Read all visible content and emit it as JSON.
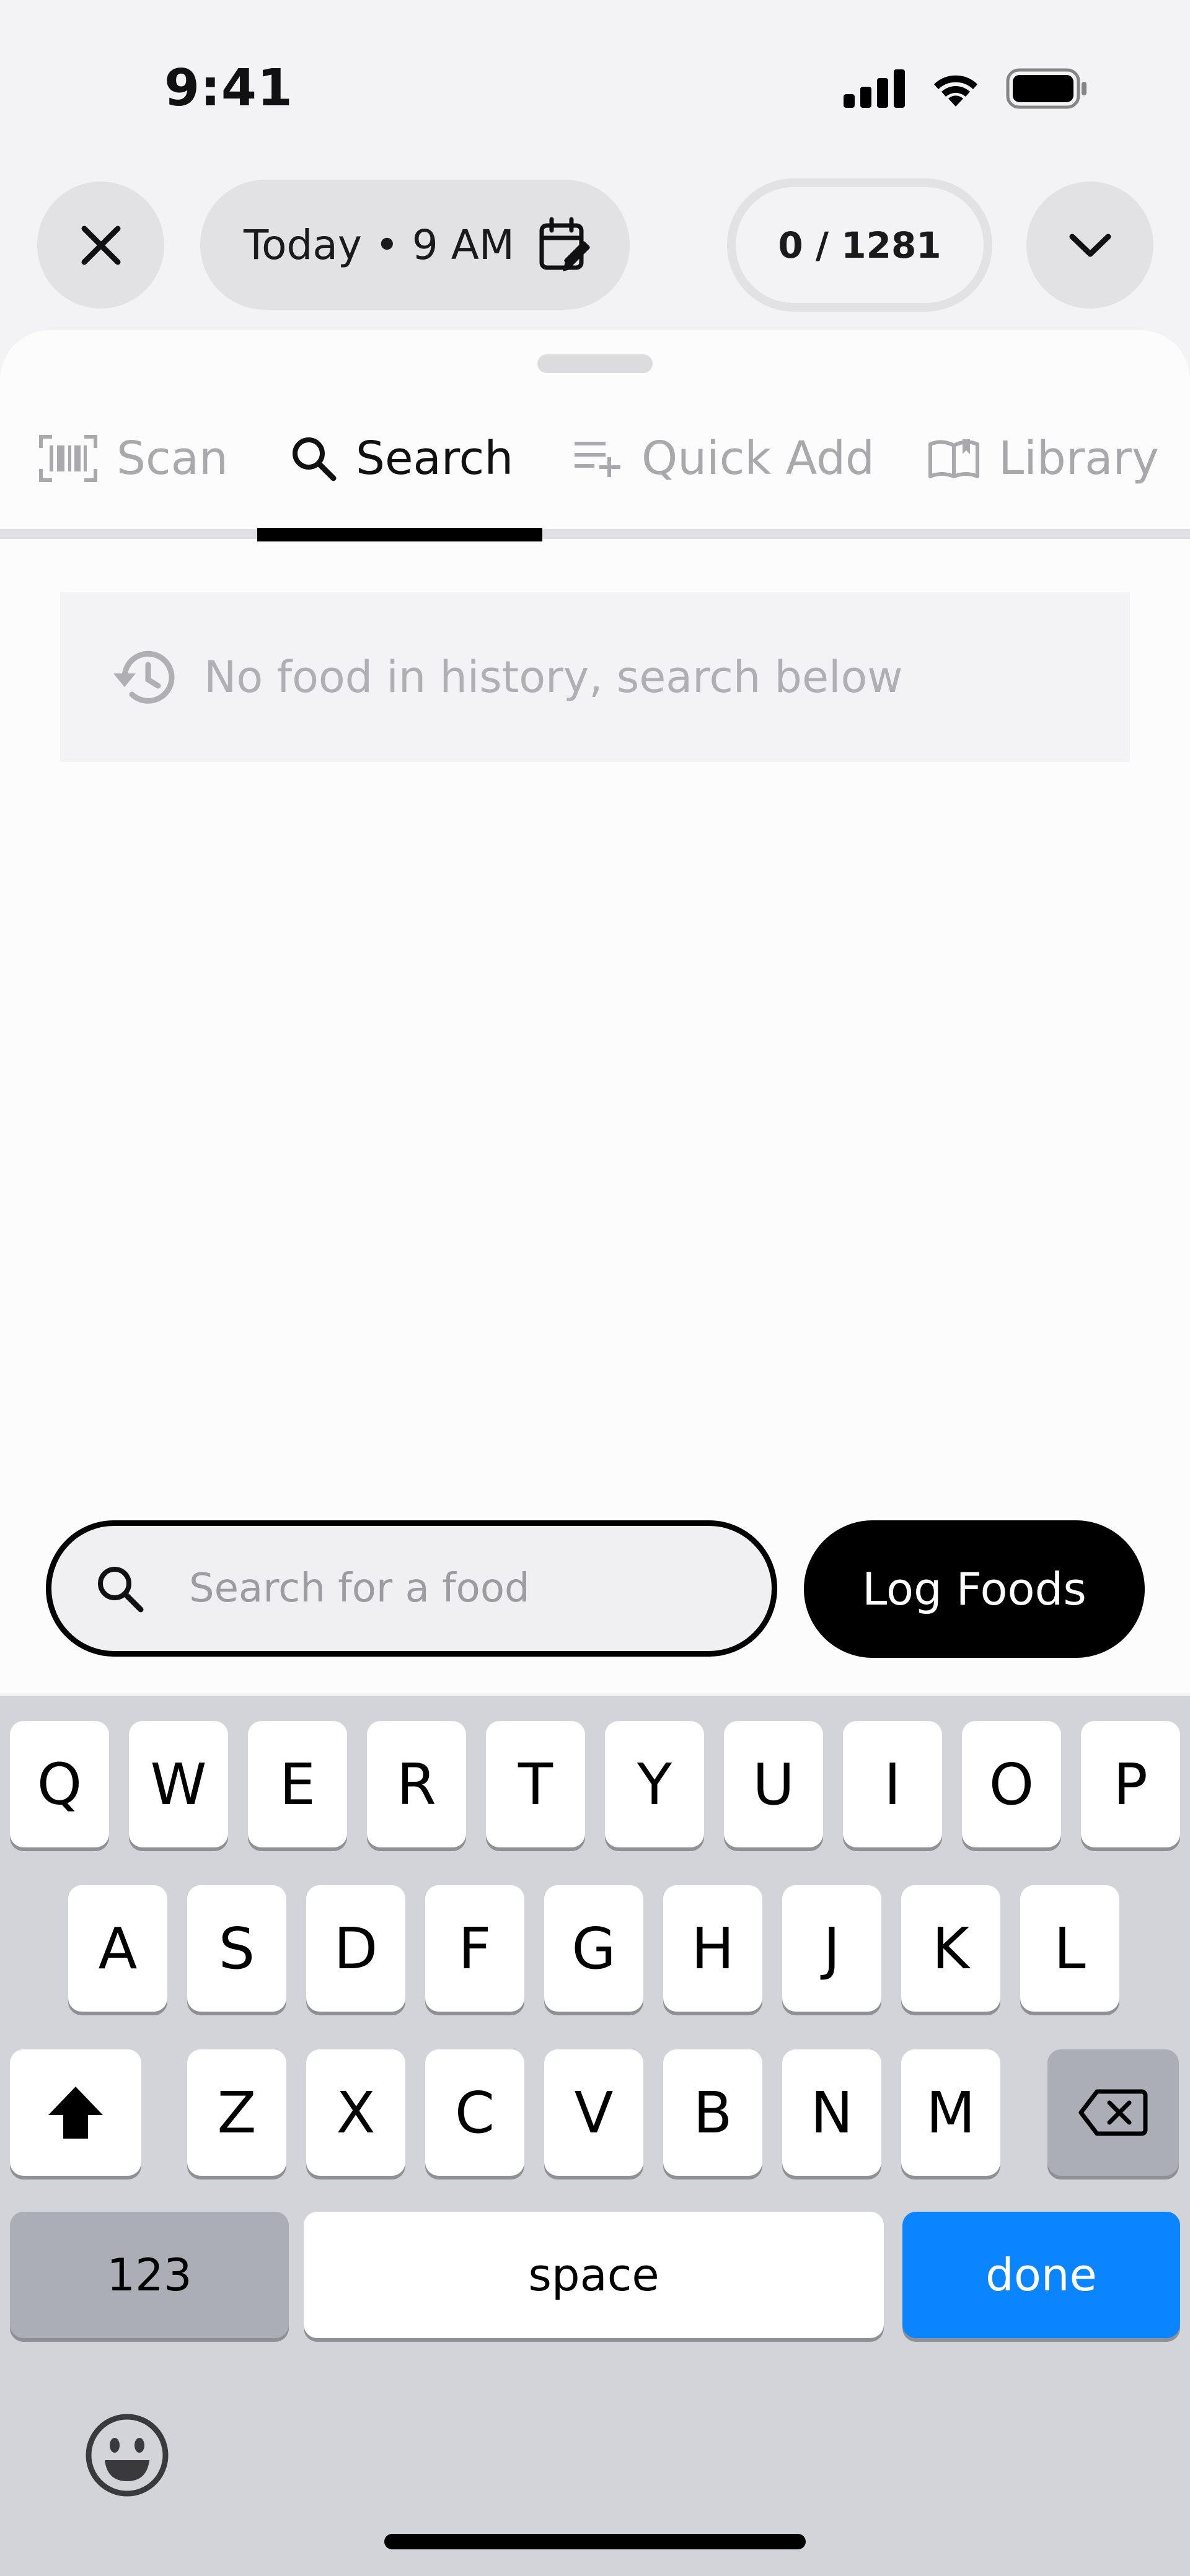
{
  "status_bar": {
    "time": "9:41"
  },
  "header": {
    "date_label": "Today • 9 AM",
    "progress_label": "0 / 1281"
  },
  "tabs": [
    {
      "label": "Scan",
      "icon": "barcode-icon",
      "active": false
    },
    {
      "label": "Search",
      "icon": "search-icon",
      "active": true
    },
    {
      "label": "Quick Add",
      "icon": "quick-add-icon",
      "active": false
    },
    {
      "label": "Library",
      "icon": "library-icon",
      "active": false
    }
  ],
  "history": {
    "empty_text": "No food in history, search below"
  },
  "search": {
    "placeholder": "Search for a food",
    "value": ""
  },
  "actions": {
    "log_foods_label": "Log Foods"
  },
  "keyboard": {
    "row1": [
      "Q",
      "W",
      "E",
      "R",
      "T",
      "Y",
      "U",
      "I",
      "O",
      "P"
    ],
    "row2": [
      "A",
      "S",
      "D",
      "F",
      "G",
      "H",
      "J",
      "K",
      "L"
    ],
    "row3": [
      "Z",
      "X",
      "C",
      "V",
      "B",
      "N",
      "M"
    ],
    "numbers_label": "123",
    "space_label": "space",
    "done_label": "done"
  },
  "colors": {
    "accent": "#0a84ff",
    "primary_button": "#000000",
    "muted_text": "#a9a8ad"
  }
}
